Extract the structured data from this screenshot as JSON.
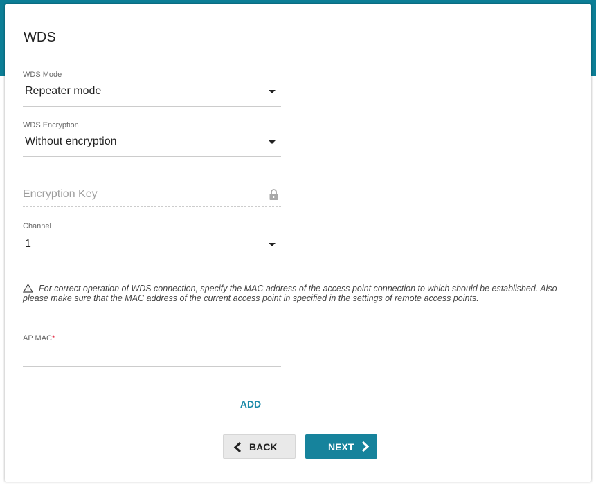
{
  "page": {
    "title": "WDS",
    "accent_color": "#0c7e96",
    "button_color": "#16839c"
  },
  "fields": {
    "wds_mode": {
      "label": "WDS Mode",
      "value": "Repeater mode"
    },
    "wds_encryption": {
      "label": "WDS Encryption",
      "value": "Without encryption"
    },
    "encryption_key": {
      "placeholder": "Encryption Key",
      "icon": "lock-icon"
    },
    "channel": {
      "label": "Channel",
      "value": "1"
    },
    "ap_mac": {
      "label": "AP MAC",
      "required_mark": "*",
      "value": ""
    }
  },
  "notice": {
    "icon": "warning-icon",
    "text": "For correct operation of WDS connection, specify the MAC address of the access point connection to which should be established. Also please make sure that the MAC address of the current access point in specified in the settings of remote access points."
  },
  "actions": {
    "add_label": "ADD",
    "back_label": "BACK",
    "next_label": "NEXT"
  }
}
